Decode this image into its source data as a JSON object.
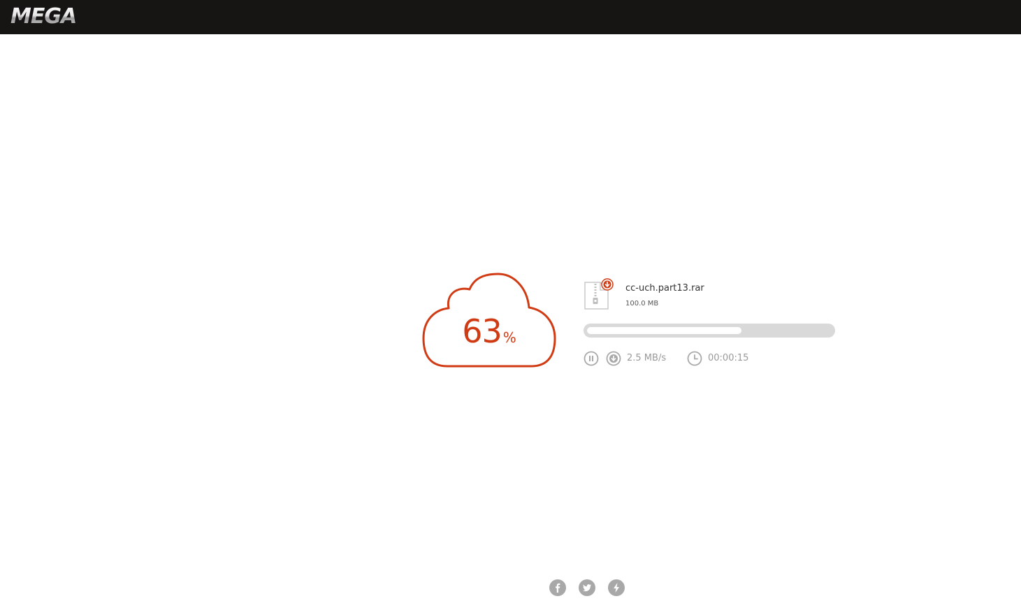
{
  "header": {
    "logo_text": "MEGA"
  },
  "download": {
    "percent": "63",
    "percent_sign": "%",
    "progress_fraction": 0.63,
    "file_name": "cc-uch.part13.rar",
    "file_size": "100.0 MB",
    "speed": "2.5 MB/s",
    "time_remaining": "00:00:15"
  },
  "icons": {
    "cloud": "cloud-icon",
    "file": "archive-file-icon",
    "download_badge": "download-badge-icon",
    "pause": "pause-icon",
    "speed": "download-arrow-icon",
    "clock": "clock-icon",
    "facebook": "facebook-icon",
    "twitter": "twitter-icon",
    "lightning": "lightning-icon"
  },
  "colors": {
    "accent": "#d03b14",
    "header_bg": "#161514",
    "progress_track": "#d9d9d9",
    "muted": "#999999"
  }
}
